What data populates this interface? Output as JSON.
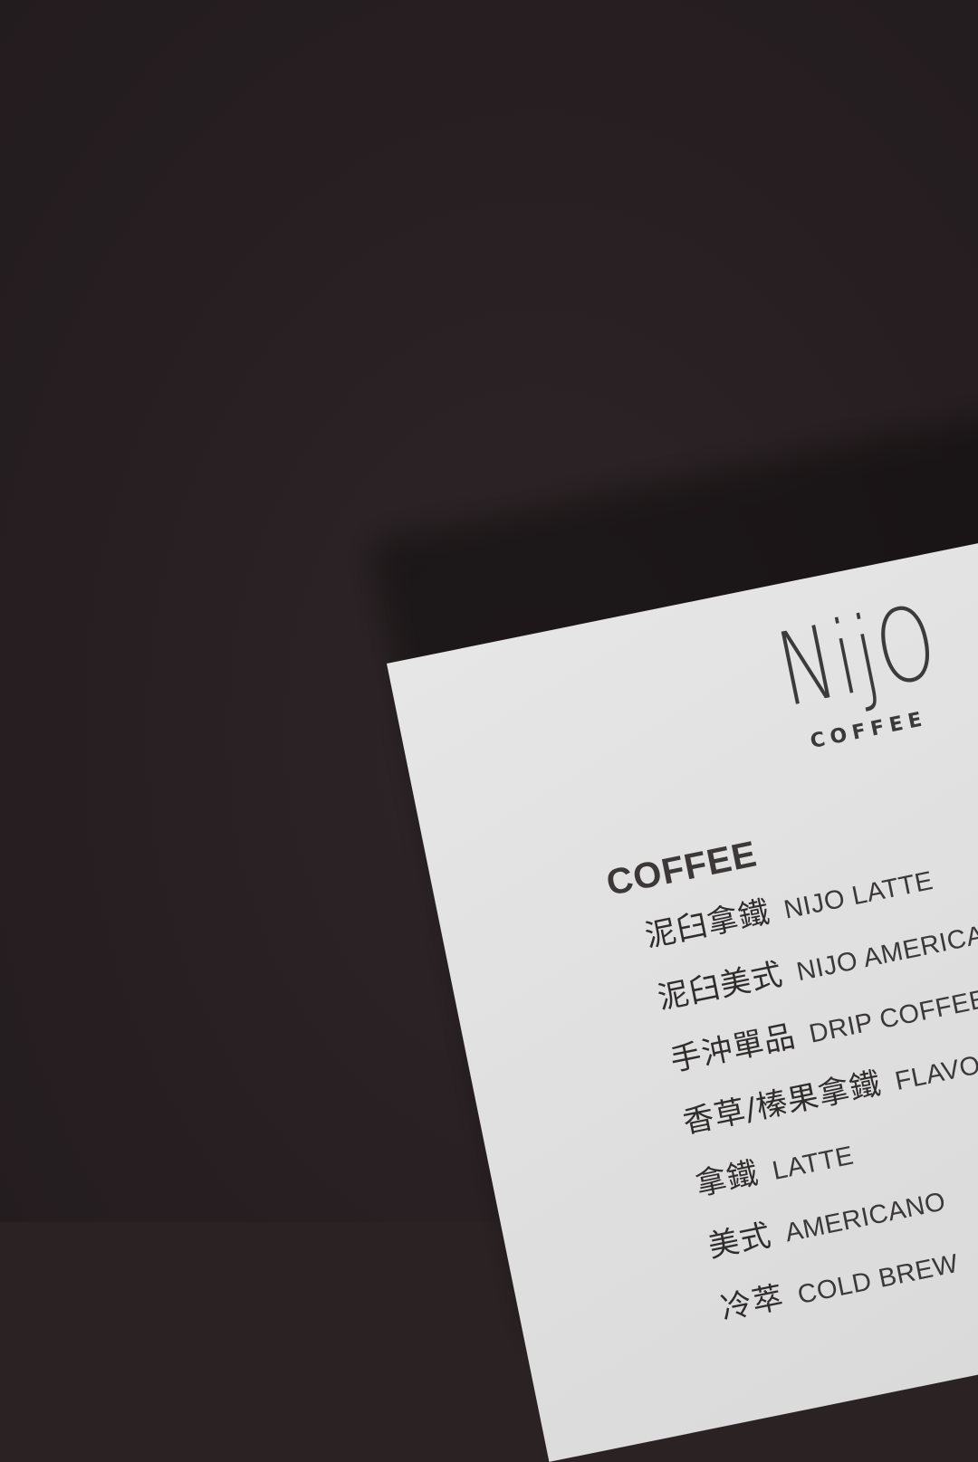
{
  "logo": {
    "wordmark": "NijO",
    "subtitle": "COFFEE"
  },
  "menu": {
    "section_title": "COFFEE",
    "items": [
      {
        "zh": "泥臼拿鐵",
        "en": "NIJO LATTE"
      },
      {
        "zh": "泥臼美式",
        "en": "NIJO AMERICANO"
      },
      {
        "zh": "手沖單品",
        "en": "DRIP COFFEE"
      },
      {
        "zh": "香草/榛果拿鐵",
        "en": "FLAVOR LATTE"
      },
      {
        "zh": "拿鐵",
        "en": "LATTE"
      },
      {
        "zh": "美式",
        "en": "AMERICANO"
      },
      {
        "zh": "冷萃",
        "en": "COLD BREW"
      }
    ]
  },
  "colors": {
    "background": "#2a2223",
    "paper": "#e2e2e2",
    "ink": "#3a3838"
  }
}
